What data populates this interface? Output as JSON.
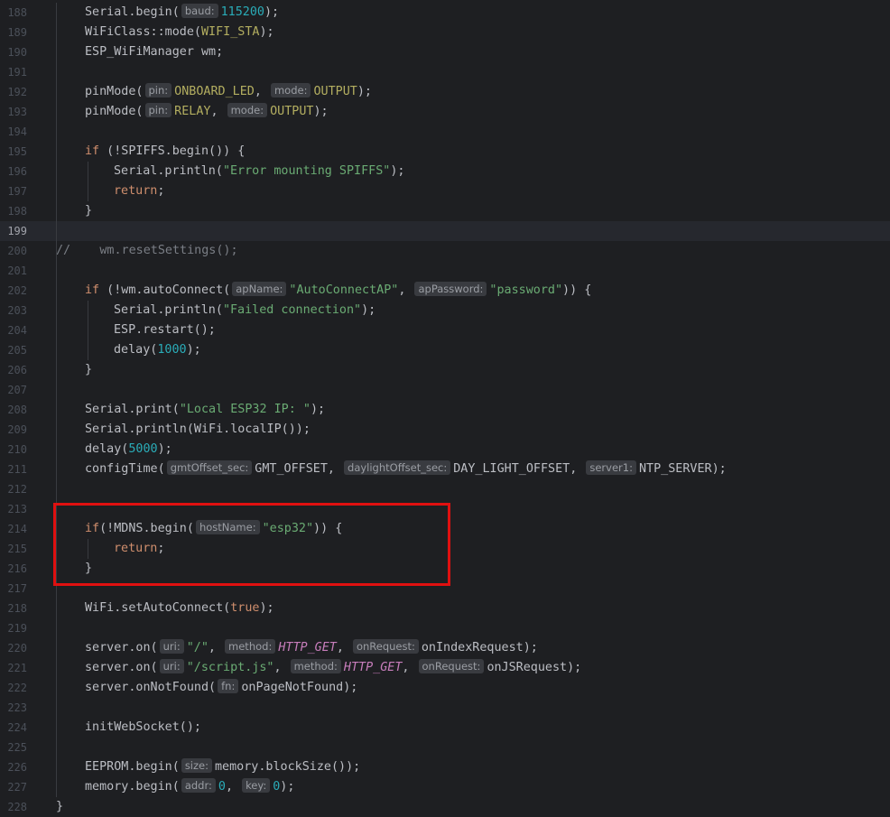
{
  "editor": {
    "current_line": "199",
    "lines": [
      {
        "n": "188",
        "indent": 1,
        "tokens": [
          {
            "t": "Serial.begin("
          },
          {
            "h": "baud:"
          },
          {
            "t": "115200",
            "c": "num"
          },
          {
            "t": ");"
          }
        ]
      },
      {
        "n": "189",
        "indent": 1,
        "tokens": [
          {
            "t": "WiFiClass::mode("
          },
          {
            "t": "WIFI_STA",
            "c": "macro"
          },
          {
            "t": ");"
          }
        ]
      },
      {
        "n": "190",
        "indent": 1,
        "tokens": [
          {
            "t": "ESP_WiFiManager wm;"
          }
        ]
      },
      {
        "n": "191",
        "indent": 0,
        "tokens": []
      },
      {
        "n": "192",
        "indent": 1,
        "tokens": [
          {
            "t": "pinMode("
          },
          {
            "h": "pin:"
          },
          {
            "t": "ONBOARD_LED",
            "c": "macro"
          },
          {
            "t": ", "
          },
          {
            "h": "mode:"
          },
          {
            "t": "OUTPUT",
            "c": "macro"
          },
          {
            "t": ");"
          }
        ]
      },
      {
        "n": "193",
        "indent": 1,
        "tokens": [
          {
            "t": "pinMode("
          },
          {
            "h": "pin:"
          },
          {
            "t": "RELAY",
            "c": "macro"
          },
          {
            "t": ", "
          },
          {
            "h": "mode:"
          },
          {
            "t": "OUTPUT",
            "c": "macro"
          },
          {
            "t": ");"
          }
        ]
      },
      {
        "n": "194",
        "indent": 0,
        "tokens": []
      },
      {
        "n": "195",
        "indent": 1,
        "tokens": [
          {
            "t": "if",
            "c": "kw"
          },
          {
            "t": " (!SPIFFS.begin()) {"
          }
        ]
      },
      {
        "n": "196",
        "indent": 2,
        "tokens": [
          {
            "t": "Serial.println("
          },
          {
            "t": "\"Error mounting SPIFFS\"",
            "c": "str"
          },
          {
            "t": ");"
          }
        ]
      },
      {
        "n": "197",
        "indent": 2,
        "tokens": [
          {
            "t": "return",
            "c": "kw"
          },
          {
            "t": ";"
          }
        ]
      },
      {
        "n": "198",
        "indent": 1,
        "tokens": [
          {
            "t": "}"
          }
        ]
      },
      {
        "n": "199",
        "indent": 0,
        "tokens": []
      },
      {
        "n": "200",
        "indent": 0,
        "tokens": [
          {
            "t": "//    wm.resetSettings();",
            "c": "cmt"
          }
        ]
      },
      {
        "n": "201",
        "indent": 0,
        "tokens": []
      },
      {
        "n": "202",
        "indent": 1,
        "tokens": [
          {
            "t": "if",
            "c": "kw"
          },
          {
            "t": " (!wm.autoConnect("
          },
          {
            "h": "apName:"
          },
          {
            "t": "\"AutoConnectAP\"",
            "c": "str"
          },
          {
            "t": ", "
          },
          {
            "h": "apPassword:"
          },
          {
            "t": "\"password\"",
            "c": "str"
          },
          {
            "t": ")) {"
          }
        ]
      },
      {
        "n": "203",
        "indent": 2,
        "tokens": [
          {
            "t": "Serial.println("
          },
          {
            "t": "\"Failed connection\"",
            "c": "str"
          },
          {
            "t": ");"
          }
        ]
      },
      {
        "n": "204",
        "indent": 2,
        "tokens": [
          {
            "t": "ESP.restart();"
          }
        ]
      },
      {
        "n": "205",
        "indent": 2,
        "tokens": [
          {
            "t": "delay("
          },
          {
            "t": "1000",
            "c": "num"
          },
          {
            "t": ");"
          }
        ]
      },
      {
        "n": "206",
        "indent": 1,
        "tokens": [
          {
            "t": "}"
          }
        ]
      },
      {
        "n": "207",
        "indent": 0,
        "tokens": []
      },
      {
        "n": "208",
        "indent": 1,
        "tokens": [
          {
            "t": "Serial.print("
          },
          {
            "t": "\"Local ESP32 IP: \"",
            "c": "str"
          },
          {
            "t": ");"
          }
        ]
      },
      {
        "n": "209",
        "indent": 1,
        "tokens": [
          {
            "t": "Serial.println(WiFi.localIP());"
          }
        ]
      },
      {
        "n": "210",
        "indent": 1,
        "tokens": [
          {
            "t": "delay("
          },
          {
            "t": "5000",
            "c": "num"
          },
          {
            "t": ");"
          }
        ]
      },
      {
        "n": "211",
        "indent": 1,
        "tokens": [
          {
            "t": "configTime("
          },
          {
            "h": "gmtOffset_sec:"
          },
          {
            "t": "GMT_OFFSET, "
          },
          {
            "h": "daylightOffset_sec:"
          },
          {
            "t": "DAY_LIGHT_OFFSET, "
          },
          {
            "h": "server1:"
          },
          {
            "t": "NTP_SERVER);"
          }
        ]
      },
      {
        "n": "212",
        "indent": 0,
        "tokens": []
      },
      {
        "n": "213",
        "indent": 0,
        "tokens": []
      },
      {
        "n": "214",
        "indent": 1,
        "tokens": [
          {
            "t": "if",
            "c": "kw"
          },
          {
            "t": "(!MDNS.begin("
          },
          {
            "h": "hostName:"
          },
          {
            "t": "\"esp32\"",
            "c": "str"
          },
          {
            "t": ")) {"
          }
        ]
      },
      {
        "n": "215",
        "indent": 2,
        "tokens": [
          {
            "t": "return",
            "c": "kw"
          },
          {
            "t": ";"
          }
        ]
      },
      {
        "n": "216",
        "indent": 1,
        "tokens": [
          {
            "t": "}"
          }
        ]
      },
      {
        "n": "217",
        "indent": 0,
        "tokens": []
      },
      {
        "n": "218",
        "indent": 1,
        "tokens": [
          {
            "t": "WiFi.setAutoConnect("
          },
          {
            "t": "true",
            "c": "kw"
          },
          {
            "t": ");"
          }
        ]
      },
      {
        "n": "219",
        "indent": 0,
        "tokens": []
      },
      {
        "n": "220",
        "indent": 1,
        "tokens": [
          {
            "t": "server.on("
          },
          {
            "h": "uri:"
          },
          {
            "t": "\"/\"",
            "c": "str"
          },
          {
            "t": ", "
          },
          {
            "h": "method:"
          },
          {
            "t": "HTTP_GET",
            "c": "const"
          },
          {
            "t": ", "
          },
          {
            "h": "onRequest:"
          },
          {
            "t": "onIndexRequest);"
          }
        ]
      },
      {
        "n": "221",
        "indent": 1,
        "tokens": [
          {
            "t": "server.on("
          },
          {
            "h": "uri:"
          },
          {
            "t": "\"/script.js\"",
            "c": "str"
          },
          {
            "t": ", "
          },
          {
            "h": "method:"
          },
          {
            "t": "HTTP_GET",
            "c": "const"
          },
          {
            "t": ", "
          },
          {
            "h": "onRequest:"
          },
          {
            "t": "onJSRequest);"
          }
        ]
      },
      {
        "n": "222",
        "indent": 1,
        "tokens": [
          {
            "t": "server.onNotFound("
          },
          {
            "h": "fn:"
          },
          {
            "t": "onPageNotFound);"
          }
        ]
      },
      {
        "n": "223",
        "indent": 0,
        "tokens": []
      },
      {
        "n": "224",
        "indent": 1,
        "tokens": [
          {
            "t": "initWebSocket();"
          }
        ]
      },
      {
        "n": "225",
        "indent": 0,
        "tokens": []
      },
      {
        "n": "226",
        "indent": 1,
        "tokens": [
          {
            "t": "EEPROM.begin("
          },
          {
            "h": "size:"
          },
          {
            "t": "memory.blockSize());"
          }
        ]
      },
      {
        "n": "227",
        "indent": 1,
        "tokens": [
          {
            "t": "memory.begin("
          },
          {
            "h": "addr:"
          },
          {
            "t": "0",
            "c": "num"
          },
          {
            "t": ", "
          },
          {
            "h": "key:"
          },
          {
            "t": "0",
            "c": "num"
          },
          {
            "t": ");"
          }
        ]
      },
      {
        "n": "228",
        "indent": 0,
        "tokens": [
          {
            "t": "}"
          }
        ]
      }
    ]
  },
  "annotation": {
    "highlight_color": "#e01010"
  }
}
